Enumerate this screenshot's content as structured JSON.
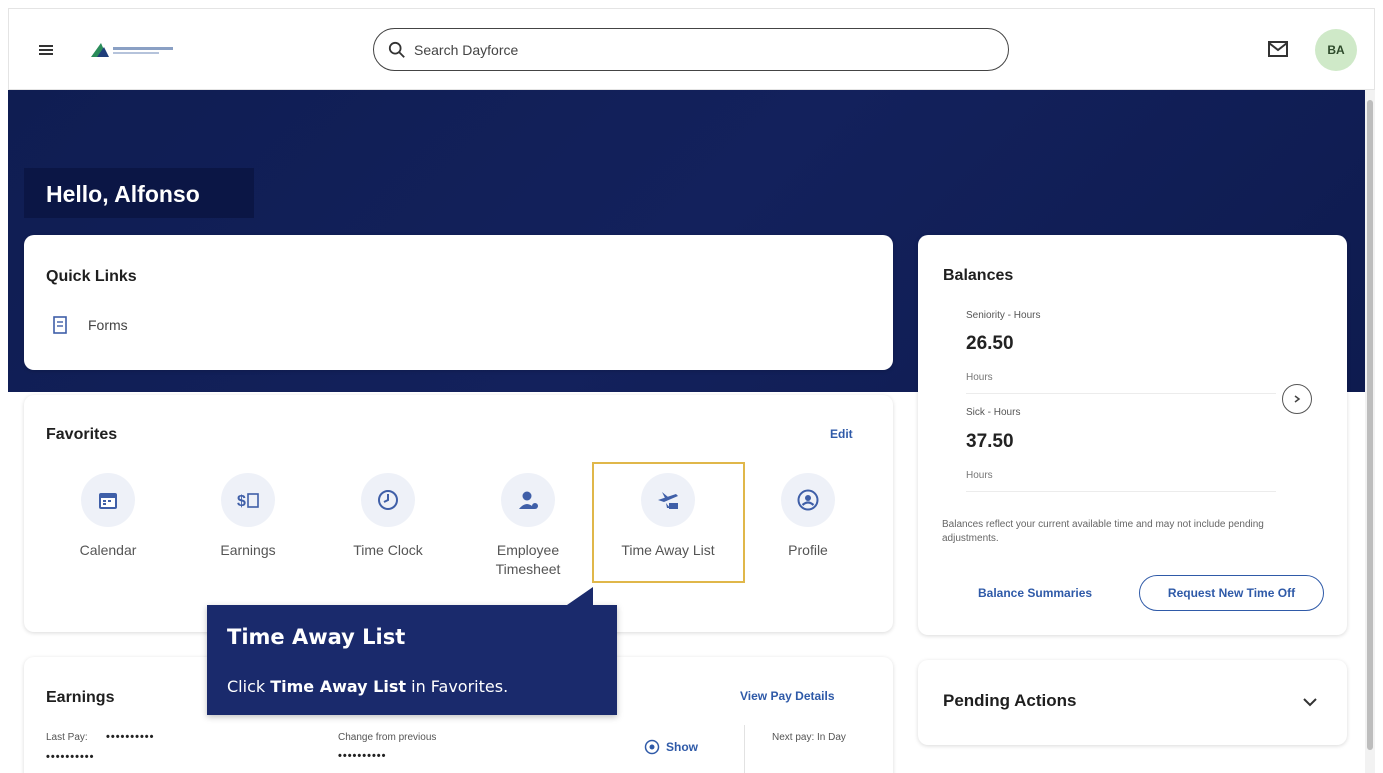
{
  "header": {
    "search_placeholder": "Search Dayforce",
    "avatar_initials": "BA"
  },
  "banner": {
    "greeting": "Hello, Alfonso"
  },
  "quick_links": {
    "title": "Quick Links",
    "items": [
      {
        "label": "Forms",
        "icon": "forms-icon"
      }
    ]
  },
  "favorites": {
    "title": "Favorites",
    "edit_label": "Edit",
    "items": [
      {
        "label": "Calendar",
        "icon": "calendar-icon"
      },
      {
        "label": "Earnings",
        "icon": "earnings-icon"
      },
      {
        "label": "Time Clock",
        "icon": "clock-icon"
      },
      {
        "label": "Employee Timesheet",
        "icon": "employee-icon"
      },
      {
        "label": "Time Away List",
        "icon": "airplane-icon"
      },
      {
        "label": "Profile",
        "icon": "profile-icon"
      }
    ]
  },
  "tooltip": {
    "title": "Time Away List",
    "body_prefix": "Click ",
    "body_bold": "Time Away List",
    "body_suffix": " in Favorites."
  },
  "earnings": {
    "title": "Earnings",
    "view_pay_label": "View Pay Details",
    "last_pay_label": "Last Pay:",
    "masked_1": "••••••••••",
    "masked_2": "••••••••••",
    "change_label": "Change from previous",
    "masked_3": "••••••••••",
    "show_label": "Show",
    "next_pay_label": "Next pay: In Day"
  },
  "balances": {
    "title": "Balances",
    "items": [
      {
        "label": "Seniority - Hours",
        "value": "26.50",
        "unit": "Hours"
      },
      {
        "label": "Sick - Hours",
        "value": "37.50",
        "unit": "Hours"
      }
    ],
    "note": "Balances reflect your current available time and may not include pending adjustments.",
    "summaries_label": "Balance Summaries",
    "request_label": "Request New Time Off"
  },
  "pending": {
    "title": "Pending Actions"
  },
  "colors": {
    "navy": "#0f1d52",
    "accent": "#2f5aa8",
    "highlight": "#e0b74a",
    "avatar_bg": "#cfe9c8"
  }
}
